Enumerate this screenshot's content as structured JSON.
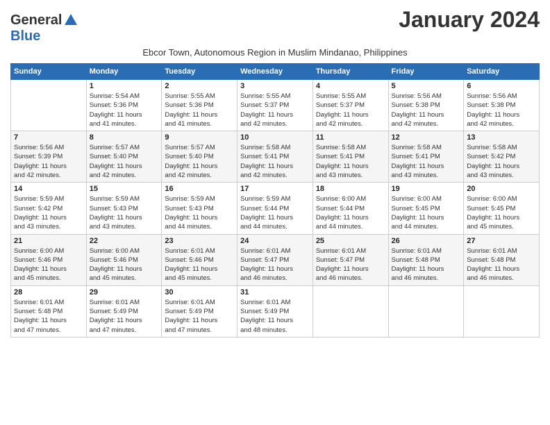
{
  "header": {
    "logo_general": "General",
    "logo_blue": "Blue",
    "month_title": "January 2024",
    "subtitle": "Ebcor Town, Autonomous Region in Muslim Mindanao, Philippines"
  },
  "days_of_week": [
    "Sunday",
    "Monday",
    "Tuesday",
    "Wednesday",
    "Thursday",
    "Friday",
    "Saturday"
  ],
  "weeks": [
    [
      {
        "day": "",
        "info": ""
      },
      {
        "day": "1",
        "info": "Sunrise: 5:54 AM\nSunset: 5:36 PM\nDaylight: 11 hours\nand 41 minutes."
      },
      {
        "day": "2",
        "info": "Sunrise: 5:55 AM\nSunset: 5:36 PM\nDaylight: 11 hours\nand 41 minutes."
      },
      {
        "day": "3",
        "info": "Sunrise: 5:55 AM\nSunset: 5:37 PM\nDaylight: 11 hours\nand 42 minutes."
      },
      {
        "day": "4",
        "info": "Sunrise: 5:55 AM\nSunset: 5:37 PM\nDaylight: 11 hours\nand 42 minutes."
      },
      {
        "day": "5",
        "info": "Sunrise: 5:56 AM\nSunset: 5:38 PM\nDaylight: 11 hours\nand 42 minutes."
      },
      {
        "day": "6",
        "info": "Sunrise: 5:56 AM\nSunset: 5:38 PM\nDaylight: 11 hours\nand 42 minutes."
      }
    ],
    [
      {
        "day": "7",
        "info": "Sunrise: 5:56 AM\nSunset: 5:39 PM\nDaylight: 11 hours\nand 42 minutes."
      },
      {
        "day": "8",
        "info": "Sunrise: 5:57 AM\nSunset: 5:40 PM\nDaylight: 11 hours\nand 42 minutes."
      },
      {
        "day": "9",
        "info": "Sunrise: 5:57 AM\nSunset: 5:40 PM\nDaylight: 11 hours\nand 42 minutes."
      },
      {
        "day": "10",
        "info": "Sunrise: 5:58 AM\nSunset: 5:41 PM\nDaylight: 11 hours\nand 42 minutes."
      },
      {
        "day": "11",
        "info": "Sunrise: 5:58 AM\nSunset: 5:41 PM\nDaylight: 11 hours\nand 43 minutes."
      },
      {
        "day": "12",
        "info": "Sunrise: 5:58 AM\nSunset: 5:41 PM\nDaylight: 11 hours\nand 43 minutes."
      },
      {
        "day": "13",
        "info": "Sunrise: 5:58 AM\nSunset: 5:42 PM\nDaylight: 11 hours\nand 43 minutes."
      }
    ],
    [
      {
        "day": "14",
        "info": "Sunrise: 5:59 AM\nSunset: 5:42 PM\nDaylight: 11 hours\nand 43 minutes."
      },
      {
        "day": "15",
        "info": "Sunrise: 5:59 AM\nSunset: 5:43 PM\nDaylight: 11 hours\nand 43 minutes."
      },
      {
        "day": "16",
        "info": "Sunrise: 5:59 AM\nSunset: 5:43 PM\nDaylight: 11 hours\nand 44 minutes."
      },
      {
        "day": "17",
        "info": "Sunrise: 5:59 AM\nSunset: 5:44 PM\nDaylight: 11 hours\nand 44 minutes."
      },
      {
        "day": "18",
        "info": "Sunrise: 6:00 AM\nSunset: 5:44 PM\nDaylight: 11 hours\nand 44 minutes."
      },
      {
        "day": "19",
        "info": "Sunrise: 6:00 AM\nSunset: 5:45 PM\nDaylight: 11 hours\nand 44 minutes."
      },
      {
        "day": "20",
        "info": "Sunrise: 6:00 AM\nSunset: 5:45 PM\nDaylight: 11 hours\nand 45 minutes."
      }
    ],
    [
      {
        "day": "21",
        "info": "Sunrise: 6:00 AM\nSunset: 5:46 PM\nDaylight: 11 hours\nand 45 minutes."
      },
      {
        "day": "22",
        "info": "Sunrise: 6:00 AM\nSunset: 5:46 PM\nDaylight: 11 hours\nand 45 minutes."
      },
      {
        "day": "23",
        "info": "Sunrise: 6:01 AM\nSunset: 5:46 PM\nDaylight: 11 hours\nand 45 minutes."
      },
      {
        "day": "24",
        "info": "Sunrise: 6:01 AM\nSunset: 5:47 PM\nDaylight: 11 hours\nand 46 minutes."
      },
      {
        "day": "25",
        "info": "Sunrise: 6:01 AM\nSunset: 5:47 PM\nDaylight: 11 hours\nand 46 minutes."
      },
      {
        "day": "26",
        "info": "Sunrise: 6:01 AM\nSunset: 5:48 PM\nDaylight: 11 hours\nand 46 minutes."
      },
      {
        "day": "27",
        "info": "Sunrise: 6:01 AM\nSunset: 5:48 PM\nDaylight: 11 hours\nand 46 minutes."
      }
    ],
    [
      {
        "day": "28",
        "info": "Sunrise: 6:01 AM\nSunset: 5:48 PM\nDaylight: 11 hours\nand 47 minutes."
      },
      {
        "day": "29",
        "info": "Sunrise: 6:01 AM\nSunset: 5:49 PM\nDaylight: 11 hours\nand 47 minutes."
      },
      {
        "day": "30",
        "info": "Sunrise: 6:01 AM\nSunset: 5:49 PM\nDaylight: 11 hours\nand 47 minutes."
      },
      {
        "day": "31",
        "info": "Sunrise: 6:01 AM\nSunset: 5:49 PM\nDaylight: 11 hours\nand 48 minutes."
      },
      {
        "day": "",
        "info": ""
      },
      {
        "day": "",
        "info": ""
      },
      {
        "day": "",
        "info": ""
      }
    ]
  ]
}
